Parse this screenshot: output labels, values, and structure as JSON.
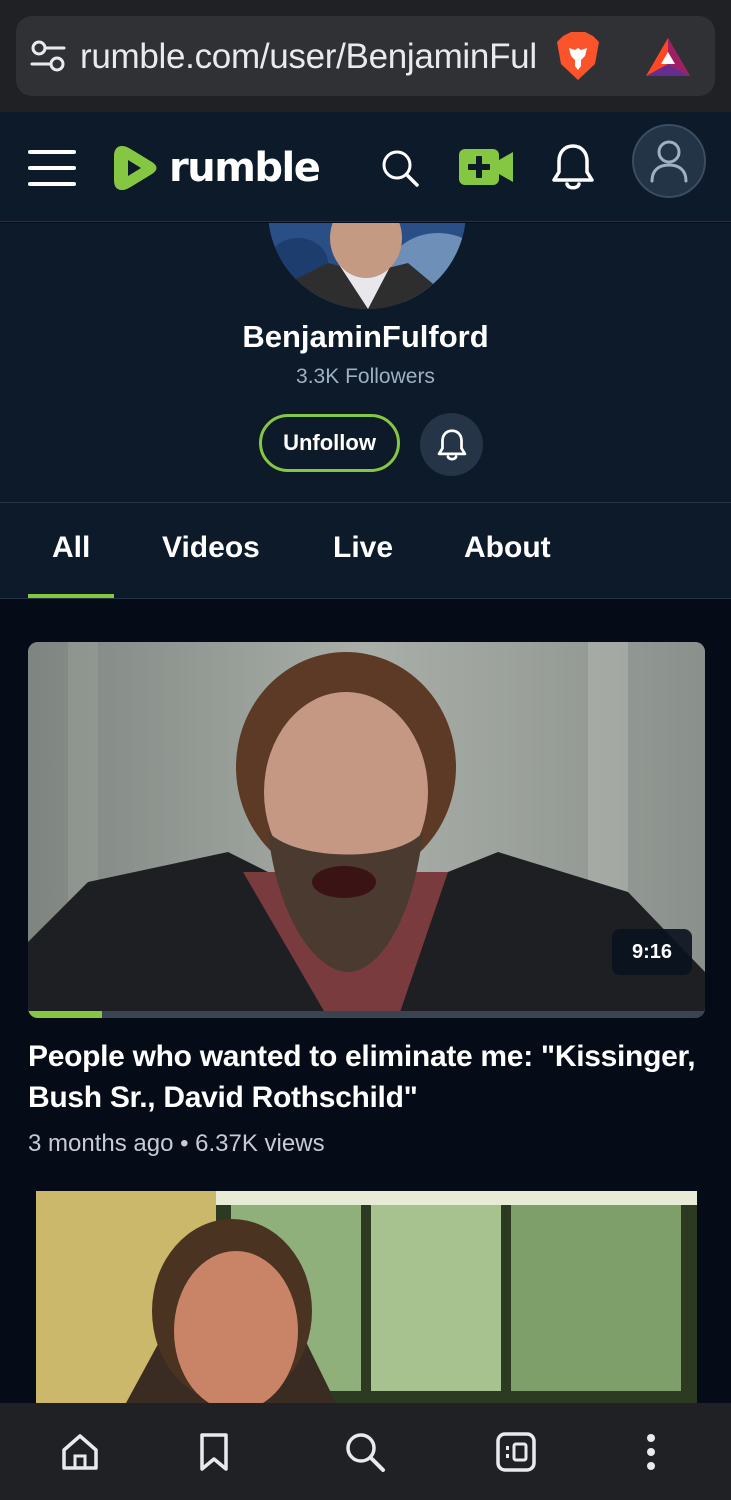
{
  "browser": {
    "url": "rumble.com/user/BenjaminFulford",
    "icons": [
      "tune-icon",
      "brave-lion-icon",
      "bat-rewards-icon"
    ]
  },
  "header": {
    "logo_text": "rumble",
    "icons": [
      "menu-icon",
      "search-icon",
      "upload-video-icon",
      "notifications-icon",
      "account-icon"
    ],
    "accent_color": "#85c742"
  },
  "channel": {
    "name": "BenjaminFulford",
    "followers": "3.3K Followers",
    "unfollow_label": "Unfollow"
  },
  "tabs": [
    {
      "label": "All",
      "active": true
    },
    {
      "label": "Videos",
      "active": false
    },
    {
      "label": "Live",
      "active": false
    },
    {
      "label": "About",
      "active": false
    }
  ],
  "videos": [
    {
      "title": "People who wanted to eliminate me: \"Kissinger, Bush Sr., David Rothschild\"",
      "meta": "3 months ago • 6.37K views",
      "duration": "9:16",
      "watched_fraction": 0.11
    }
  ],
  "bottom_nav": {
    "icons": [
      "home-icon",
      "bookmark-icon",
      "search-icon",
      "tabs-icon",
      "more-icon"
    ]
  }
}
